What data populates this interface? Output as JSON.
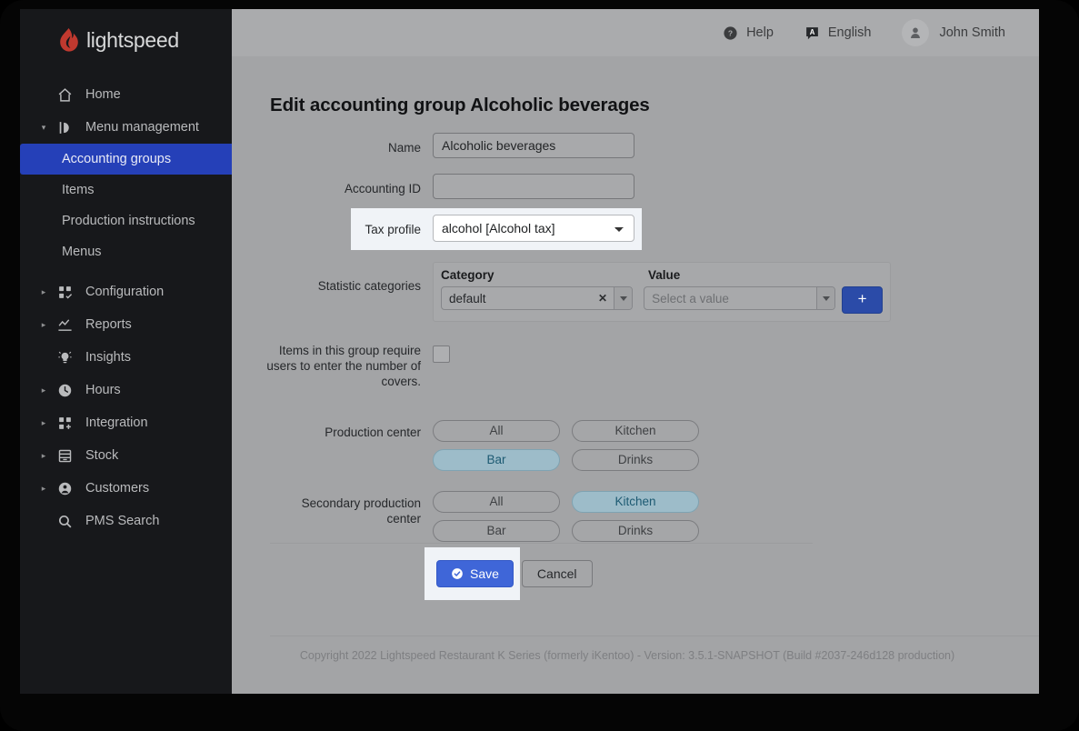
{
  "brand": {
    "name": "lightspeed",
    "logo_color": "#c0392f"
  },
  "sidebar": {
    "items": [
      {
        "label": "Home",
        "icon": "home-icon",
        "caret": "",
        "level": 0,
        "active": false
      },
      {
        "label": "Menu management",
        "icon": "menu-management-icon",
        "caret": "▾",
        "level": 0,
        "active": false
      },
      {
        "label": "Accounting groups",
        "icon": "",
        "caret": "",
        "level": 1,
        "active": true
      },
      {
        "label": "Items",
        "icon": "",
        "caret": "",
        "level": 1,
        "active": false
      },
      {
        "label": "Production instructions",
        "icon": "",
        "caret": "",
        "level": 1,
        "active": false
      },
      {
        "label": "Menus",
        "icon": "",
        "caret": "",
        "level": 1,
        "active": false
      },
      {
        "label": "Configuration",
        "icon": "configuration-icon",
        "caret": "▸",
        "level": 0,
        "active": false
      },
      {
        "label": "Reports",
        "icon": "reports-icon",
        "caret": "▸",
        "level": 0,
        "active": false
      },
      {
        "label": "Insights",
        "icon": "insights-icon",
        "caret": "",
        "level": 0,
        "active": false
      },
      {
        "label": "Hours",
        "icon": "clock-icon",
        "caret": "▸",
        "level": 0,
        "active": false
      },
      {
        "label": "Integration",
        "icon": "integration-icon",
        "caret": "▸",
        "level": 0,
        "active": false
      },
      {
        "label": "Stock",
        "icon": "stock-icon",
        "caret": "▸",
        "level": 0,
        "active": false
      },
      {
        "label": "Customers",
        "icon": "customers-icon",
        "caret": "▸",
        "level": 0,
        "active": false
      },
      {
        "label": "PMS Search",
        "icon": "search-icon",
        "caret": "",
        "level": 0,
        "active": false
      }
    ],
    "active_color": "#2540b8"
  },
  "header": {
    "help_label": "Help",
    "language_label": "English",
    "language_badge": "A",
    "user_name": "John Smith"
  },
  "main": {
    "title": "Edit accounting group Alcoholic beverages",
    "fields": {
      "name_label": "Name",
      "name_value": "Alcoholic beverages",
      "accounting_id_label": "Accounting ID",
      "accounting_id_value": "",
      "tax_profile_label": "Tax profile",
      "tax_profile_value": "alcohol [Alcohol tax]",
      "statistic_categories_label": "Statistic categories",
      "covers_label": "Items in this group require users to enter the number of covers.",
      "covers_checked": false,
      "production_center_label": "Production center",
      "secondary_production_center_label": "Secondary production center"
    },
    "statistic_categories": {
      "col_category": "Category",
      "col_value": "Value",
      "category_value": "default",
      "value_placeholder": "Select a value",
      "clear_glyph": "✕",
      "add_label": "+"
    },
    "production_center": {
      "options": [
        "All",
        "Kitchen",
        "Bar",
        "Drinks"
      ],
      "selected": "Bar"
    },
    "secondary_production_center": {
      "options": [
        "All",
        "Kitchen",
        "Bar",
        "Drinks"
      ],
      "selected": "Kitchen"
    },
    "buttons": {
      "save_label": "Save",
      "cancel_label": "Cancel"
    }
  },
  "footer": {
    "copyright": "Copyright 2022 Lightspeed Restaurant K Series (formerly iKentoo) - Version: 3.5.1-SNAPSHOT (Build #2037-246d128 production)"
  }
}
